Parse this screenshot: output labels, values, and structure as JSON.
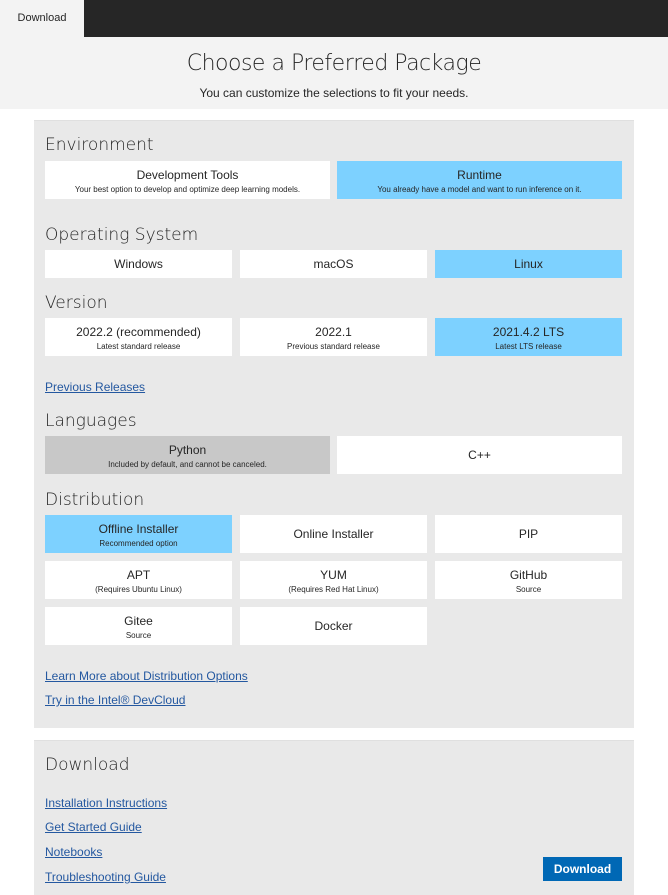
{
  "topbar": {
    "tab_label": "Download"
  },
  "header": {
    "title": "Choose a Preferred Package",
    "subtitle": "You can customize the selections to fit your needs."
  },
  "environment": {
    "title": "Environment",
    "options": [
      {
        "label": "Development Tools",
        "desc": "Your best option to develop and optimize deep learning models."
      },
      {
        "label": "Runtime",
        "desc": "You already have a model and want to run inference on it."
      }
    ]
  },
  "os": {
    "title": "Operating System",
    "options": [
      {
        "label": "Windows"
      },
      {
        "label": "macOS"
      },
      {
        "label": "Linux"
      }
    ]
  },
  "version": {
    "title": "Version",
    "options": [
      {
        "label": "2022.2 (recommended)",
        "desc": "Latest standard release"
      },
      {
        "label": "2022.1",
        "desc": "Previous standard release"
      },
      {
        "label": "2021.4.2 LTS",
        "desc": "Latest LTS release"
      }
    ],
    "previous_releases": "Previous Releases"
  },
  "languages": {
    "title": "Languages",
    "options": [
      {
        "label": "Python",
        "desc": "Included by default, and cannot be canceled."
      },
      {
        "label": "C++"
      }
    ]
  },
  "distribution": {
    "title": "Distribution",
    "options": [
      {
        "label": "Offline Installer",
        "desc": "Recommended option"
      },
      {
        "label": "Online Installer"
      },
      {
        "label": "PIP"
      },
      {
        "label": "APT",
        "desc": "(Requires Ubuntu Linux)"
      },
      {
        "label": "YUM",
        "desc": "(Requires Red Hat Linux)"
      },
      {
        "label": "GitHub",
        "desc": "Source"
      },
      {
        "label": "Gitee",
        "desc": "Source"
      },
      {
        "label": "Docker"
      }
    ],
    "learn_more": "Learn More about Distribution Options",
    "devcloud": "Try in the Intel® DevCloud"
  },
  "download": {
    "title": "Download",
    "links": [
      "Installation Instructions",
      "Get Started Guide",
      "Notebooks",
      "Troubleshooting Guide"
    ],
    "button": "Download"
  },
  "colors": {
    "selected": "#7dd1ff",
    "locked": "#c8c8c8",
    "link": "#2458a0",
    "button": "#0068b5"
  }
}
